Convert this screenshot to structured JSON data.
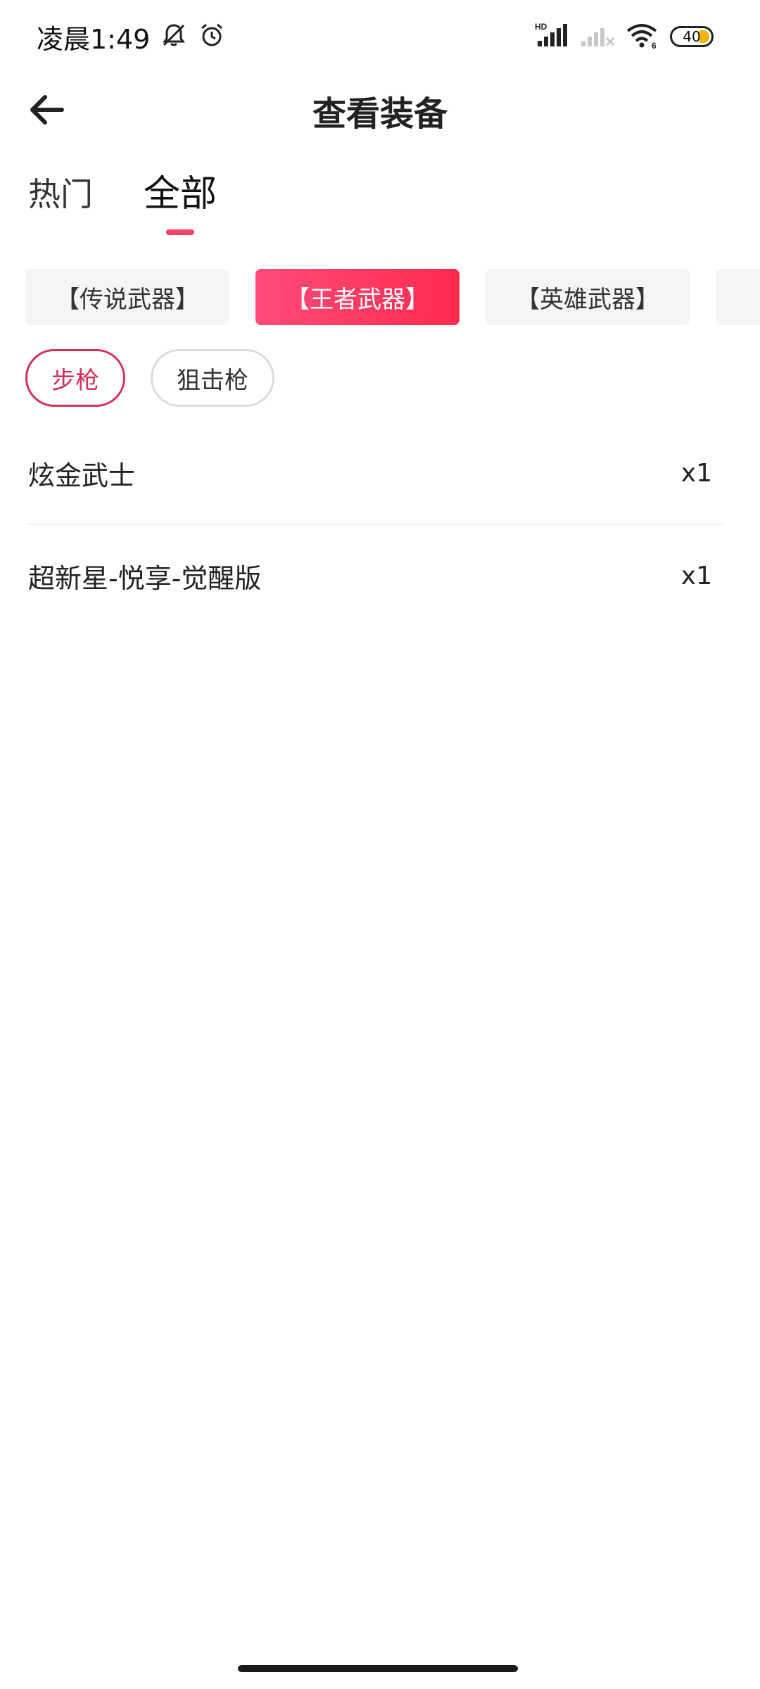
{
  "status_bar": {
    "time": "凌晨1:49",
    "battery": "40",
    "icons": [
      "muted-bell-icon",
      "alarm-icon",
      "hd-signal-icon",
      "signal-off-icon",
      "wifi-icon",
      "battery-icon"
    ]
  },
  "header": {
    "title": "查看装备",
    "back_icon": "arrow-left-icon"
  },
  "tabs": [
    {
      "label": "热门",
      "active": false
    },
    {
      "label": "全部",
      "active": true
    }
  ],
  "categories": [
    {
      "label": "【传说武器】",
      "active": false
    },
    {
      "label": "【王者武器】",
      "active": true
    },
    {
      "label": "【英雄武器】",
      "active": false
    },
    {
      "label": "【",
      "active": false
    }
  ],
  "filters": [
    {
      "label": "步枪",
      "active": true
    },
    {
      "label": "狙击枪",
      "active": false
    }
  ],
  "items": [
    {
      "name": "炫金武士",
      "qty": "x1"
    },
    {
      "name": "超新星-悦享-觉醒版",
      "qty": "x1"
    }
  ],
  "colors": {
    "accent": "#ff3d6b",
    "pill_active": "#d62e5a",
    "chip_bg": "#f3f5f7"
  }
}
